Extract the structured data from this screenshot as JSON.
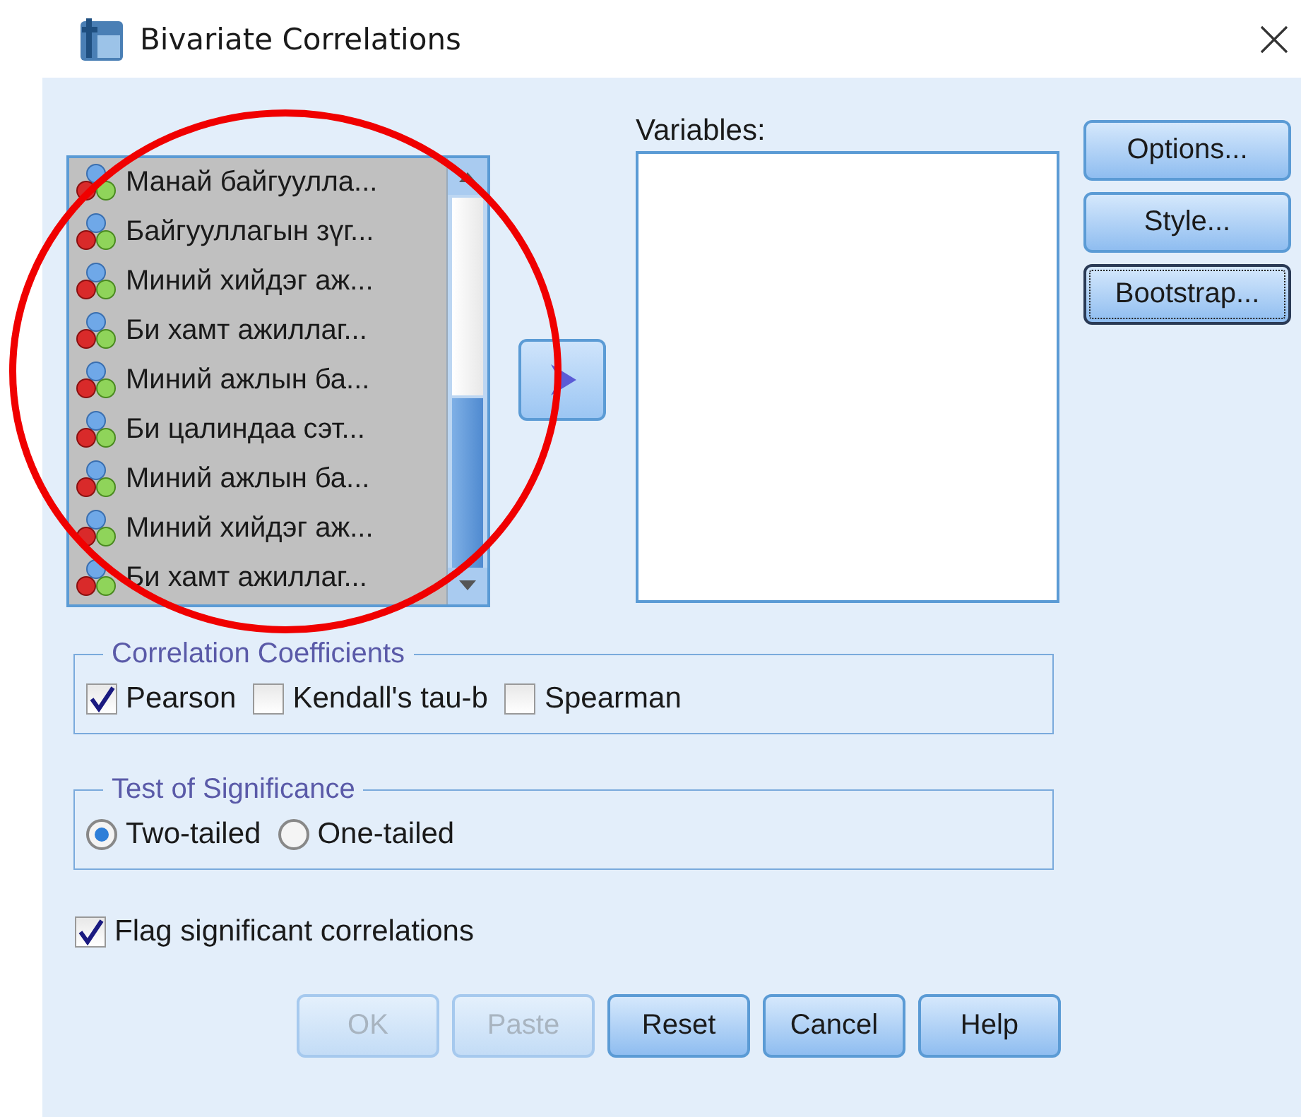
{
  "window": {
    "title": "Bivariate Correlations"
  },
  "source_list": {
    "items": [
      {
        "label": "Манай байгуулла..."
      },
      {
        "label": "Байгууллагын зүг..."
      },
      {
        "label": "Миний хийдэг аж..."
      },
      {
        "label": "Би хамт ажиллаг..."
      },
      {
        "label": "Миний ажлын ба..."
      },
      {
        "label": "Би цалиндаа сэт..."
      },
      {
        "label": "Миний ажлын ба..."
      },
      {
        "label": "Миний хийдэг аж..."
      },
      {
        "label": "Би хамт ажиллаг..."
      }
    ]
  },
  "variables": {
    "label": "Variables:"
  },
  "side_buttons": [
    {
      "label": "Options...",
      "focused": false
    },
    {
      "label": "Style...",
      "focused": false
    },
    {
      "label": "Bootstrap...",
      "focused": true
    }
  ],
  "correlation_coefficients": {
    "title": "Correlation Coefficients",
    "options": [
      {
        "label": "Pearson",
        "checked": true
      },
      {
        "label": "Kendall's tau-b",
        "checked": false
      },
      {
        "label": "Spearman",
        "checked": false
      }
    ]
  },
  "test_of_significance": {
    "title": "Test of Significance",
    "options": [
      {
        "label": "Two-tailed",
        "selected": true
      },
      {
        "label": "One-tailed",
        "selected": false
      }
    ]
  },
  "flag": {
    "label": "Flag significant correlations",
    "checked": true
  },
  "buttons": [
    {
      "label": "OK",
      "disabled": true
    },
    {
      "label": "Paste",
      "disabled": true
    },
    {
      "label": "Reset",
      "disabled": false
    },
    {
      "label": "Cancel",
      "disabled": false
    },
    {
      "label": "Help",
      "disabled": false
    }
  ]
}
